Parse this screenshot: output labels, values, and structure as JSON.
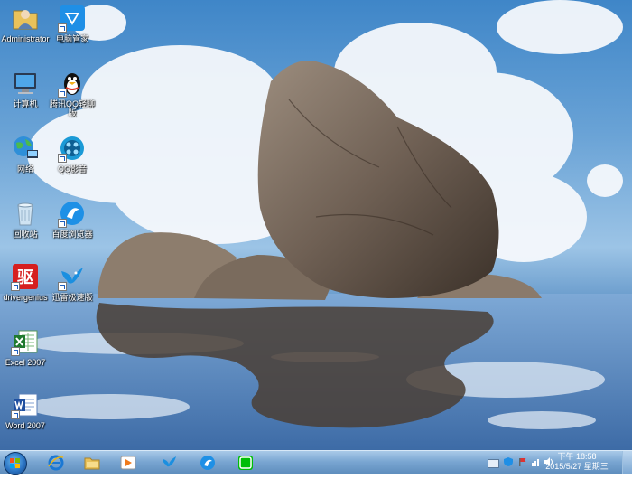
{
  "desktop": {
    "icons": [
      {
        "label": "Administrator",
        "icon": "user-folder-icon"
      },
      {
        "label": "电脑管家",
        "icon": "tencent-pc-manager-icon"
      },
      {
        "label": "计算机",
        "icon": "computer-icon"
      },
      {
        "label": "腾讯QQ轻聊版",
        "icon": "qq-penguin-icon"
      },
      {
        "label": "网络",
        "icon": "network-globe-icon"
      },
      {
        "label": "QQ影音",
        "icon": "qq-player-icon"
      },
      {
        "label": "回收站",
        "icon": "recycle-bin-icon"
      },
      {
        "label": "百度浏览器",
        "icon": "baidu-browser-icon"
      },
      {
        "label": "drivergenius",
        "icon": "driver-genius-icon"
      },
      {
        "label": "迅雷极速版",
        "icon": "thunder-bird-icon"
      },
      {
        "label": "Excel 2007",
        "icon": "excel-icon"
      },
      {
        "label": "Word 2007",
        "icon": "word-icon"
      }
    ],
    "driver_glyph": "驱"
  },
  "taskbar": {
    "pinned": [
      {
        "name": "internet-explorer",
        "icon": "ie-icon"
      },
      {
        "name": "file-explorer",
        "icon": "folder-icon"
      },
      {
        "name": "media-player",
        "icon": "media-player-icon"
      },
      {
        "name": "thunder",
        "icon": "thunder-bird-icon"
      },
      {
        "name": "baidu-browser",
        "icon": "baidu-browser-icon"
      },
      {
        "name": "iqiyi",
        "icon": "iqiyi-icon"
      }
    ],
    "clock": {
      "time": "下午 18:58",
      "date": "2015/5/27 星期三"
    }
  },
  "colors": {
    "sky": "#5a96d0",
    "rock": "#6e5f52",
    "taskbar": "#7aa6d2"
  }
}
